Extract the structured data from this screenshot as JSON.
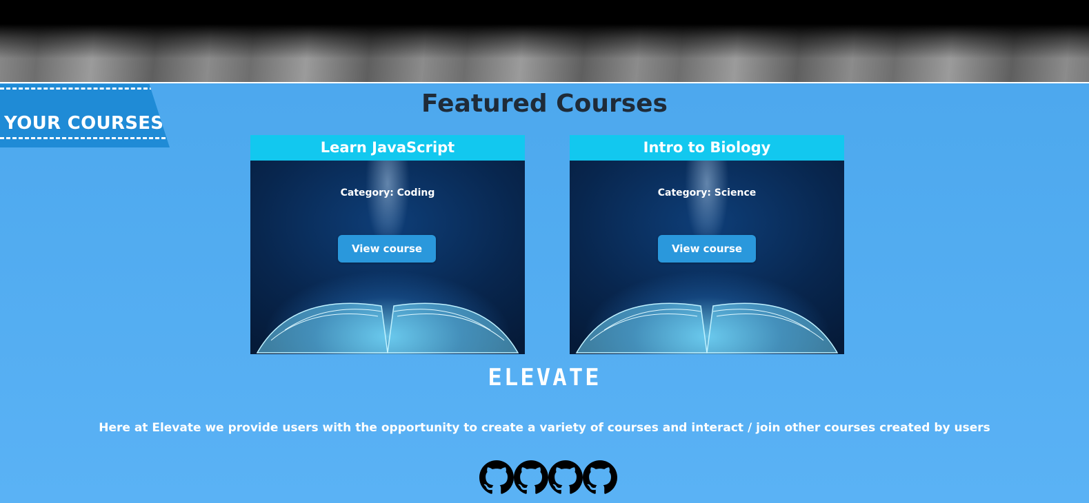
{
  "ribbon": {
    "label": "YOUR COURSES"
  },
  "page": {
    "title": "Featured Courses"
  },
  "courses": [
    {
      "title": "Learn JavaScript",
      "category": "Category: Coding",
      "button": "View course"
    },
    {
      "title": "Intro to Biology",
      "category": "Category: Science",
      "button": "View course"
    }
  ],
  "footer": {
    "logo": "ELEVATE",
    "tagline": "Here at Elevate we provide users with the opportunity to create a variety of courses and interact / join other courses created by users",
    "social_icons": [
      "github-icon",
      "github-icon",
      "github-icon",
      "github-icon"
    ]
  },
  "colors": {
    "background": "#4aa6ec",
    "card_header": "#12c8ef",
    "button": "#2a98dc",
    "ribbon": "#1f8bd6",
    "title_text": "#1f2b38"
  }
}
